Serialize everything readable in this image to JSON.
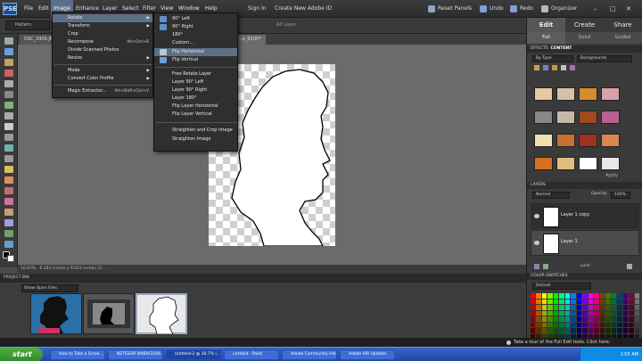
{
  "menubar": {
    "logo": "PSE",
    "items": [
      {
        "label": "File"
      },
      {
        "label": "Edit"
      },
      {
        "label": "Image"
      },
      {
        "label": "Enhance"
      },
      {
        "label": "Layer"
      },
      {
        "label": "Select"
      },
      {
        "label": "Filter"
      },
      {
        "label": "View"
      },
      {
        "label": "Window"
      },
      {
        "label": "Help"
      }
    ],
    "sign_in": "Sign In",
    "create_id": "Create New Adobe ID",
    "reset_panels": "Reset Panels",
    "undo": "Undo",
    "redo": "Redo",
    "organizer": "Organizer"
  },
  "options_bar": {
    "select_value": "Pattern",
    "as_layer": "Alt Layer"
  },
  "tabs": [
    {
      "label": "DSC_2909.JP..."
    },
    {
      "label": "...e_63(8)*"
    }
  ],
  "image_menu": {
    "items": [
      {
        "label": "Rotate",
        "shortcut": "",
        "submenu": true
      },
      {
        "label": "Transform",
        "shortcut": "",
        "submenu": true
      },
      {
        "label": "Crop",
        "shortcut": ""
      },
      {
        "label": "Recompose",
        "shortcut": "Alt+Ctrl+R"
      },
      {
        "label": "Divide Scanned Photos",
        "shortcut": ""
      },
      {
        "label": "Resize",
        "shortcut": "",
        "submenu": true
      },
      {
        "label": "Mode",
        "shortcut": "",
        "submenu": true
      },
      {
        "label": "Convert Color Profile",
        "shortcut": "",
        "submenu": true
      },
      {
        "label": "Magic Extractor...",
        "shortcut": "Alt+Shift+Ctrl+V"
      }
    ]
  },
  "rotate_menu": {
    "items": [
      {
        "label": "90° Left"
      },
      {
        "label": "90° Right"
      },
      {
        "label": "180°"
      },
      {
        "label": "Custom..."
      },
      {
        "label": "Flip Horizontal"
      },
      {
        "label": "Flip Vertical"
      },
      {
        "label": "Free Rotate Layer"
      },
      {
        "label": "Layer 90° Left"
      },
      {
        "label": "Layer 90° Right"
      },
      {
        "label": "Layer 180°"
      },
      {
        "label": "Flip Layer Horizontal"
      },
      {
        "label": "Flip Layer Vertical"
      },
      {
        "label": "Straighten and Crop Image"
      },
      {
        "label": "Straighten Image"
      }
    ]
  },
  "status": {
    "zoom": "16.67%",
    "doc_size": "6.283 inches x 9.023 inches (3..."
  },
  "project_bin": {
    "title": "PROJECT BIN",
    "select_value": "Show Open Files"
  },
  "right_panel": {
    "tabs": [
      {
        "label": "Edit"
      },
      {
        "label": "Create"
      },
      {
        "label": "Share"
      }
    ],
    "subtabs": [
      {
        "label": "Full"
      },
      {
        "label": "Quick"
      },
      {
        "label": "Guided"
      }
    ],
    "effects_title": "EFFECTS",
    "content_title": "CONTENT",
    "by_type": "By Type",
    "backgrounds": "Backgrounds",
    "apply": "Apply",
    "layers_title": "LAYERS",
    "blend_mode": "Normal",
    "opacity_label": "Opacity:",
    "opacity_value": "100%",
    "lock_label": "Lock:",
    "layers": [
      {
        "name": "Layer 1 copy"
      },
      {
        "name": "Layer 1"
      }
    ],
    "swatches_title": "COLOR SWATCHES",
    "swatch_set": "Default"
  },
  "tour": {
    "text": "Take a tour of the Full Edit tools. Click here."
  },
  "taskbar": {
    "start": "start",
    "tasks": [
      {
        "label": "How to Take a Scree..."
      },
      {
        "label": "NETGEAR WNDA3100..."
      },
      {
        "label": "Untitled-2 @ 16.7% (..."
      },
      {
        "label": "untitled - Paint"
      },
      {
        "label": "Adobe Community Help"
      },
      {
        "label": "Adobe AIR Updater"
      }
    ],
    "clock": "1:55 AM"
  },
  "colors": {
    "menu_highlight": "#5d6f86",
    "taskbar": "#245edb",
    "start": "#3c9b36"
  }
}
